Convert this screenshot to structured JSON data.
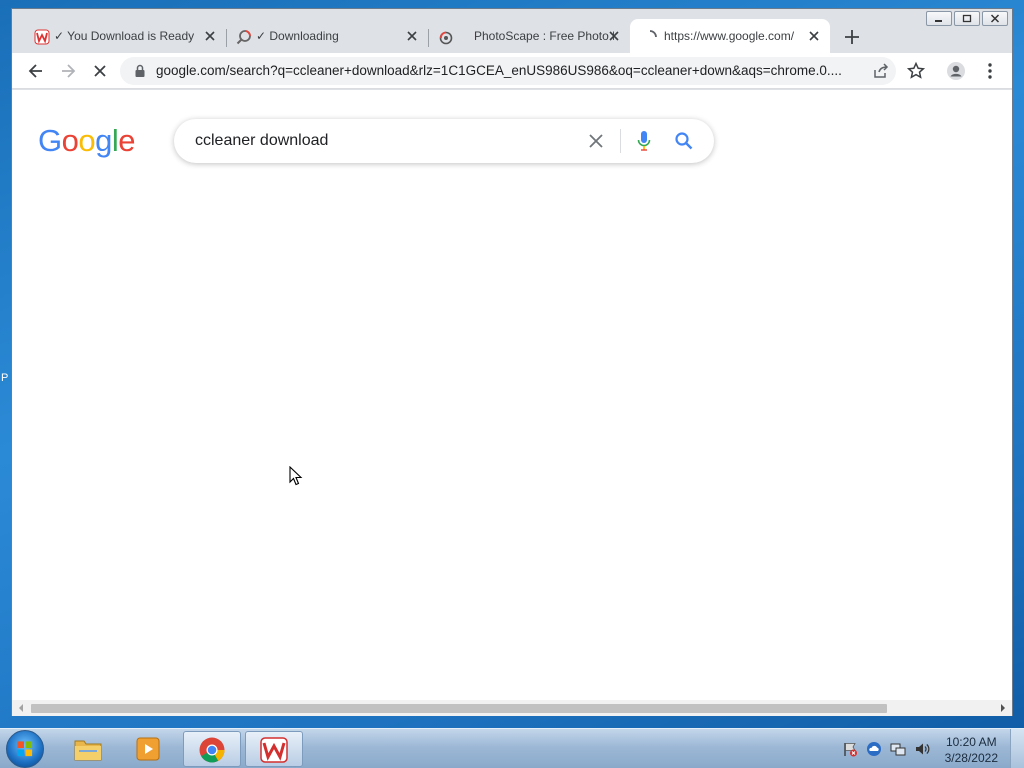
{
  "desktop": {
    "edge_text": "P"
  },
  "browser": {
    "tabs": [
      {
        "title": "✓ You Download is Ready",
        "favicon": "wps-icon",
        "active": false
      },
      {
        "title": "✓ Downloading",
        "favicon": "search-loader-icon",
        "active": false
      },
      {
        "title": "PhotoScape : Free Photo E",
        "favicon": "photoscape-icon",
        "active": false
      },
      {
        "title": "https://www.google.com/",
        "favicon": "loading-spinner-icon",
        "active": true
      }
    ],
    "address_url": "google.com/search?q=ccleaner+download&rlz=1C1GCEA_enUS986US986&oq=ccleaner+down&aqs=chrome.0...."
  },
  "page": {
    "logo_letters": [
      "G",
      "o",
      "o",
      "g",
      "l",
      "e"
    ],
    "logo_colors": [
      "#4285f4",
      "#ea4335",
      "#fbbc05",
      "#4285f4",
      "#34a853",
      "#ea4335"
    ],
    "search_query": "ccleaner download"
  },
  "taskbar": {
    "apps": [
      "explorer",
      "media-player",
      "chrome",
      "wps-office"
    ],
    "clock_time": "10:20 AM",
    "clock_date": "3/28/2022"
  }
}
